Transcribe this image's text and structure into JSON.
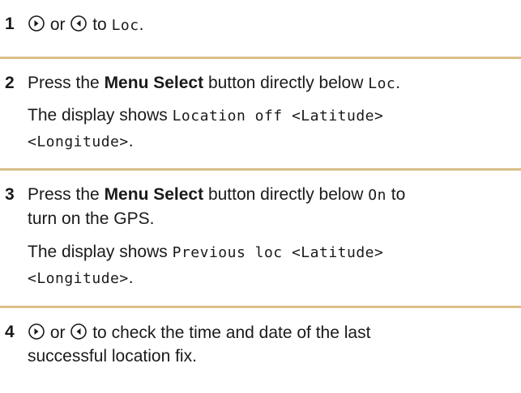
{
  "steps": [
    {
      "number": "1",
      "lines": [
        {
          "or": "or",
          "to_text": "to",
          "code": "Loc",
          "end": "."
        }
      ]
    },
    {
      "number": "2",
      "press": "Press the",
      "bold": "Menu Select",
      "rest": "button directly below",
      "code": "Loc",
      "end": ".",
      "display_prefix": "The display shows",
      "display_code_1": "Location off <Latitude>",
      "display_code_2": "<Longitude>",
      "display_end": "."
    },
    {
      "number": "3",
      "press": "Press the",
      "bold": "Menu Select",
      "rest": "button directly below",
      "code": "On",
      "after": "to",
      "line2": "turn on the GPS.",
      "display_prefix": "The display shows",
      "display_code_1": "Previous loc <Latitude>",
      "display_code_2": "<Longitude>",
      "display_end": "."
    },
    {
      "number": "4",
      "or": "or",
      "line1_rest": "to check the time and date of the last",
      "line2": "successful location fix."
    }
  ],
  "colors": {
    "divider": "#d9c089",
    "text": "#1a1a1a"
  },
  "icons": [
    "right-arrow-key-icon",
    "left-arrow-key-icon"
  ]
}
